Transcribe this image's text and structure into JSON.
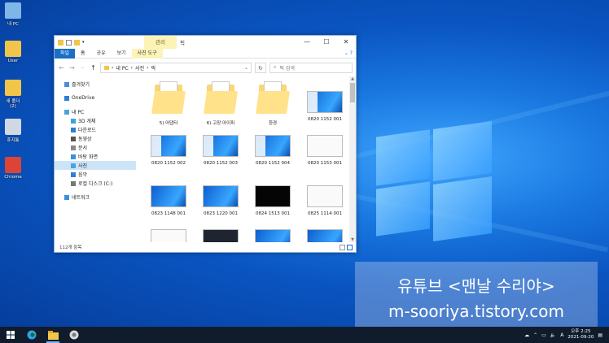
{
  "desktop": {
    "icons": [
      {
        "label": "내 PC",
        "color": "#7fb6e8"
      },
      {
        "label": "User",
        "color": "#f1c54a"
      },
      {
        "label": "새 폴더 (2)",
        "color": "#f1c54a"
      },
      {
        "label": "휴지통",
        "color": "#cfd8e3"
      },
      {
        "label": "Chrome",
        "color": "#db4437"
      }
    ]
  },
  "watermark": {
    "line1": "유튜브 <맨날 수리야>",
    "line2": "m-sooriya.tistory.com"
  },
  "explorer": {
    "title": "픽",
    "context_tab": "관리",
    "ribbon_tabs": [
      "파일",
      "홈",
      "공유",
      "보기",
      "사진 도구"
    ],
    "breadcrumb": [
      "내 PC",
      "사진",
      "픽"
    ],
    "search_placeholder": "픽 검색",
    "nav": [
      {
        "label": "즐겨찾기",
        "icon": "star-icon",
        "color": "#4a8fd6"
      },
      {
        "label": "OneDrive",
        "icon": "cloud-icon",
        "color": "#2d7fd6"
      },
      {
        "label": "내 PC",
        "icon": "pc-icon",
        "color": "#4aa3df"
      },
      {
        "label": "3D 개체",
        "icon": "cube-icon",
        "color": "#3aa3e0"
      },
      {
        "label": "다운로드",
        "icon": "download-icon",
        "color": "#2d7fd6"
      },
      {
        "label": "동영상",
        "icon": "video-icon",
        "color": "#555555"
      },
      {
        "label": "문서",
        "icon": "document-icon",
        "color": "#888888"
      },
      {
        "label": "바탕 화면",
        "icon": "desktop-icon",
        "color": "#3a8fe0"
      },
      {
        "label": "사진",
        "icon": "picture-icon",
        "color": "#4aa3df"
      },
      {
        "label": "음악",
        "icon": "music-icon",
        "color": "#2d7fd6"
      },
      {
        "label": "로컬 디스크 (C:)",
        "icon": "disk-icon",
        "color": "#777777"
      },
      {
        "label": "네트워크",
        "icon": "network-icon",
        "color": "#3a8fe0"
      }
    ],
    "items": [
      {
        "label": "5) 어댑터",
        "kind": "folder"
      },
      {
        "label": "6) 고장 아이피",
        "kind": "folder"
      },
      {
        "label": "환경",
        "kind": "folder"
      },
      {
        "label": "0820 1152 001",
        "kind": "blue"
      },
      {
        "label": "0820 1152 002",
        "kind": "blue"
      },
      {
        "label": "0820 1152 003",
        "kind": "blue"
      },
      {
        "label": "0820 1152 004",
        "kind": "blue"
      },
      {
        "label": "0820 1153 001",
        "kind": "white"
      },
      {
        "label": "0823 1148 001",
        "kind": "blueplain"
      },
      {
        "label": "0823 1220 001",
        "kind": "blueplain"
      },
      {
        "label": "0824 1513 001",
        "kind": "black"
      },
      {
        "label": "0825 1114 001",
        "kind": "white"
      },
      {
        "label": "",
        "kind": "white"
      },
      {
        "label": "",
        "kind": "dark"
      },
      {
        "label": "",
        "kind": "blueplain"
      },
      {
        "label": "",
        "kind": "blueplain"
      }
    ],
    "status": "112개 항목"
  },
  "taskbar": {
    "clock_ampm_time": "오후 2:25",
    "clock_date": "2021-09-20",
    "ime": "A"
  }
}
